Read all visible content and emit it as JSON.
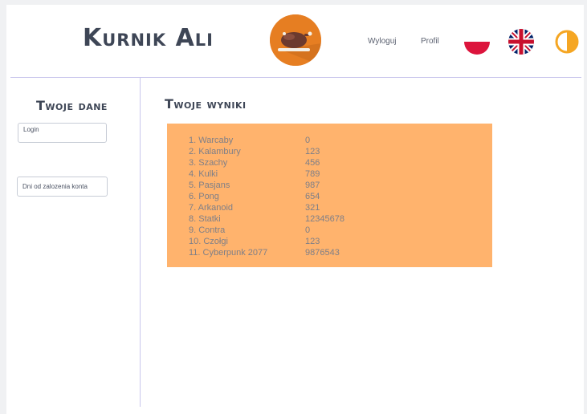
{
  "header": {
    "brand": "Kurnik Ali",
    "nav": {
      "logout": "Wyloguj",
      "profile": "Profil"
    }
  },
  "sidebar": {
    "title": "Twoje dane",
    "login_label": "Login",
    "days_label": "Dni od zalozenia konta"
  },
  "results": {
    "title": "Twoje wyniki",
    "rows": [
      {
        "name": "1. Warcaby",
        "score": "0"
      },
      {
        "name": "2. Kalambury",
        "score": "123"
      },
      {
        "name": "3. Szachy",
        "score": "456"
      },
      {
        "name": "4. Kulki",
        "score": "789"
      },
      {
        "name": "5. Pasjans",
        "score": "987"
      },
      {
        "name": "6. Pong",
        "score": "654"
      },
      {
        "name": "7. Arkanoid",
        "score": "321"
      },
      {
        "name": "8. Statki",
        "score": "12345678"
      },
      {
        "name": "9. Contra",
        "score": "0"
      },
      {
        "name": "10. Czołgi",
        "score": "123"
      },
      {
        "name": "11. Cyberpunk 2077",
        "score": "9876543"
      }
    ]
  },
  "icons": {
    "logo": "roast-chicken-logo",
    "flag_pl": "poland-flag-icon",
    "flag_en": "uk-flag-icon",
    "theme": "theme-toggle-icon"
  },
  "colors": {
    "accent": "#e67e22",
    "results_bg": "#ffb36d",
    "text_dark": "#3e4656",
    "divider": "#c9c6ec"
  }
}
